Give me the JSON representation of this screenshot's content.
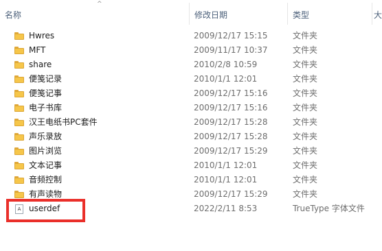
{
  "columns": {
    "name": "名称",
    "date": "修改日期",
    "type": "类型",
    "size": "大"
  },
  "sort_indicator": "^",
  "files": [
    {
      "name": "Hwres",
      "date": "2009/12/17 15:15",
      "type": "文件夹",
      "icon": "folder-icon"
    },
    {
      "name": "MFT",
      "date": "2009/11/17 10:37",
      "type": "文件夹",
      "icon": "folder-icon"
    },
    {
      "name": "share",
      "date": "2010/2/8 10:59",
      "type": "文件夹",
      "icon": "folder-icon"
    },
    {
      "name": "便笺记录",
      "date": "2010/1/1 12:01",
      "type": "文件夹",
      "icon": "folder-icon"
    },
    {
      "name": "便笺记事",
      "date": "2009/12/17 15:16",
      "type": "文件夹",
      "icon": "folder-icon"
    },
    {
      "name": "电子书库",
      "date": "2009/12/17 15:16",
      "type": "文件夹",
      "icon": "folder-icon"
    },
    {
      "name": "汉王电纸书PC套件",
      "date": "2009/12/17 15:28",
      "type": "文件夹",
      "icon": "folder-icon"
    },
    {
      "name": "声乐录放",
      "date": "2009/12/17 15:28",
      "type": "文件夹",
      "icon": "folder-icon"
    },
    {
      "name": "图片浏览",
      "date": "2009/12/17 15:29",
      "type": "文件夹",
      "icon": "folder-icon"
    },
    {
      "name": "文本记事",
      "date": "2010/1/1 12:01",
      "type": "文件夹",
      "icon": "folder-icon"
    },
    {
      "name": "音频控制",
      "date": "2010/1/1 12:01",
      "type": "文件夹",
      "icon": "folder-icon"
    },
    {
      "name": "有声读物",
      "date": "2009/12/17 15:29",
      "type": "文件夹",
      "icon": "folder-icon"
    },
    {
      "name": "userdef",
      "date": "2022/2/11 8:53",
      "type": "TrueType 字体文件",
      "icon": "font-file-icon",
      "icon_glyph": "A"
    }
  ],
  "highlight_color": "#ea2f2a"
}
